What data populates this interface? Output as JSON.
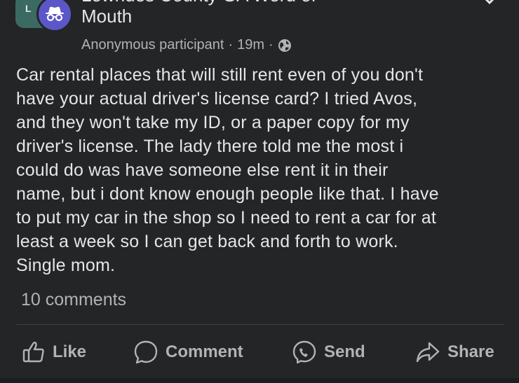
{
  "post": {
    "group_name_line1": "Lowndes County GA Word of",
    "group_name_line2": "Mouth",
    "group_avatar_text": "L",
    "author": "Anonymous participant",
    "time": "19m",
    "body": "Car rental places that will still rent even of you don't\nhave your actual driver's license card? I tried Avos,\nand they won't take my ID, or a paper copy for my\ndriver's license. The lady there told me the most i\ncould do was have someone else rent it in their\nname, but i dont know enough people like that. I have\nto put my car in the shop so I need to rent a car for at\nleast a week so I can get back and forth to work.\nSingle mom.",
    "comments": "10 comments"
  },
  "actions": {
    "like": "Like",
    "comment": "Comment",
    "send": "Send",
    "share": "Share"
  },
  "icons": {
    "like": "thumbs-up-icon",
    "comment": "comment-icon",
    "send": "messenger-icon",
    "share": "share-arrow-icon",
    "privacy": "globe-icon",
    "close": "close-icon",
    "anon": "incognito-icon"
  },
  "colors": {
    "background": "#242526",
    "text": "#e4e6eb",
    "secondary": "#b0b3b8",
    "anon_avatar": "#5b57c8",
    "group_avatar": "#3b6a63"
  }
}
